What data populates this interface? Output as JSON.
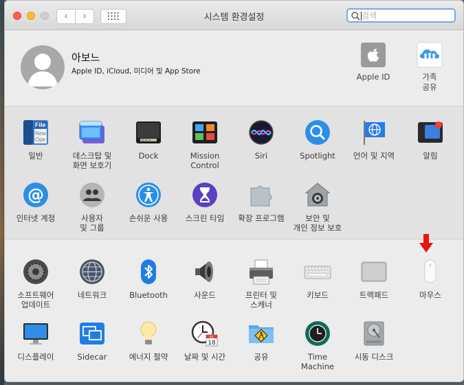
{
  "window": {
    "title": "시스템 환경설정"
  },
  "toolbar": {
    "back_label": "‹",
    "forward_label": "›"
  },
  "search": {
    "placeholder": "검색",
    "value": ""
  },
  "user": {
    "name": "아보느",
    "subtitle": "Apple ID, iCloud, 미디어 및 App Store"
  },
  "top_panes": [
    {
      "label": "Apple ID",
      "icon": "apple-logo-icon"
    },
    {
      "label": "가족\n공유",
      "icon": "family-sharing-icon"
    }
  ],
  "panes_row1": [
    {
      "label": "일반",
      "icon": "general-icon"
    },
    {
      "label": "데스크탑 및\n화면 보호기",
      "icon": "desktop-icon"
    },
    {
      "label": "Dock",
      "icon": "dock-icon"
    },
    {
      "label": "Mission\nControl",
      "icon": "mission-control-icon"
    },
    {
      "label": "Siri",
      "icon": "siri-icon"
    },
    {
      "label": "Spotlight",
      "icon": "spotlight-icon"
    },
    {
      "label": "언어 및 지역",
      "icon": "language-flag-icon"
    },
    {
      "label": "알림",
      "icon": "notifications-icon"
    }
  ],
  "panes_row2": [
    {
      "label": "인터넷 계정",
      "icon": "internet-accounts-icon"
    },
    {
      "label": "사용자\n및 그룹",
      "icon": "users-groups-icon"
    },
    {
      "label": "손쉬운 사용",
      "icon": "accessibility-icon"
    },
    {
      "label": "스크린 타임",
      "icon": "screen-time-icon"
    },
    {
      "label": "확장 프로그램",
      "icon": "extensions-icon"
    },
    {
      "label": "보안 및\n개인 정보 보호",
      "icon": "security-house-icon"
    }
  ],
  "panes_row3": [
    {
      "label": "소프트웨어\n업데이트",
      "icon": "software-update-icon"
    },
    {
      "label": "네트워크",
      "icon": "network-icon"
    },
    {
      "label": "Bluetooth",
      "icon": "bluetooth-icon"
    },
    {
      "label": "사운드",
      "icon": "sound-icon"
    },
    {
      "label": "프린터 및\n스캐너",
      "icon": "printer-icon"
    },
    {
      "label": "키보드",
      "icon": "keyboard-icon"
    },
    {
      "label": "트랙패드",
      "icon": "trackpad-icon"
    },
    {
      "label": "마우스",
      "icon": "mouse-icon"
    }
  ],
  "panes_row4": [
    {
      "label": "디스플레이",
      "icon": "display-icon"
    },
    {
      "label": "Sidecar",
      "icon": "sidecar-icon"
    },
    {
      "label": "에너지 절약",
      "icon": "lightbulb-icon"
    },
    {
      "label": "날짜 및 시간",
      "icon": "clock-calendar-icon"
    },
    {
      "label": "공유",
      "icon": "sharing-folder-icon"
    },
    {
      "label": "Time\nMachine",
      "icon": "time-machine-icon"
    },
    {
      "label": "시동 디스크",
      "icon": "startup-disk-icon"
    }
  ],
  "calendar_icon_text": {
    "month": "JUL",
    "day": "18"
  },
  "colors": {
    "close": "#fe5f57",
    "minimize": "#febc2e",
    "zoom": "#cfcfcf",
    "accent": "#2a7be4",
    "arrow": "#e8160c"
  }
}
